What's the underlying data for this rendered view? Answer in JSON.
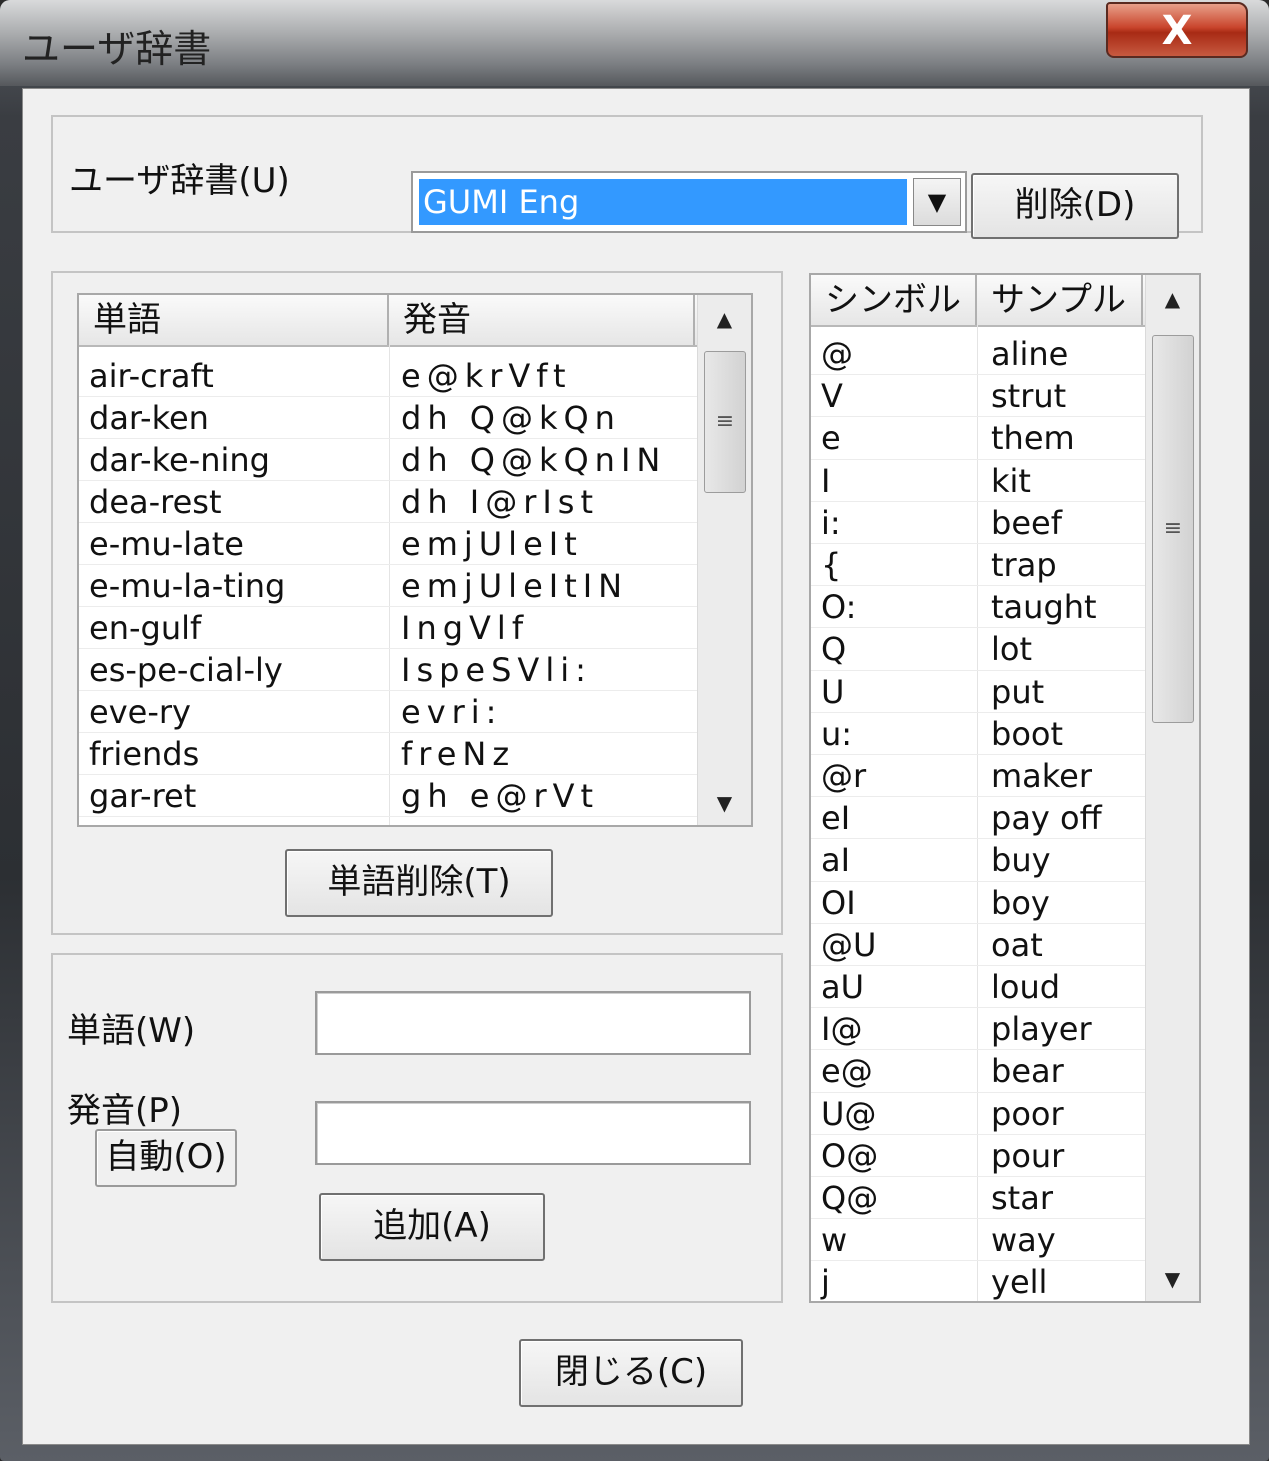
{
  "window": {
    "title": "ユーザ辞書",
    "close_glyph": "X"
  },
  "dictionary": {
    "label": "ユーザ辞書(U)",
    "selected": "GUMI Eng",
    "delete_label": "削除(D)"
  },
  "word_list": {
    "columns": [
      "単語",
      "発音"
    ],
    "rows": [
      {
        "word": "air-craft",
        "pron": "e@krVft"
      },
      {
        "word": "dar-ken",
        "pron": "dh Q@kQn"
      },
      {
        "word": "dar-ke-ning",
        "pron": "dh Q@kQnIN"
      },
      {
        "word": "dea-rest",
        "pron": "dh I@rIst"
      },
      {
        "word": "e-mu-late",
        "pron": "emjUleIt"
      },
      {
        "word": "e-mu-la-ting",
        "pron": "emjUleItIN"
      },
      {
        "word": "en-gulf",
        "pron": "IngVlf"
      },
      {
        "word": "es-pe-cial-ly",
        "pron": "IspeSVli:"
      },
      {
        "word": "eve-ry",
        "pron": "evri:"
      },
      {
        "word": "friends",
        "pron": "freNz"
      },
      {
        "word": "gar-ret",
        "pron": "gh e@rVt"
      }
    ],
    "delete_word_label": "単語削除(T)"
  },
  "entry": {
    "word_label": "単語(W)",
    "pron_label": "発音(P)",
    "auto_label": "自動(O)",
    "add_label": "追加(A)"
  },
  "symbols": {
    "columns": [
      "シンボル",
      "サンプル"
    ],
    "rows": [
      {
        "symbol": "@",
        "sample": "aline"
      },
      {
        "symbol": "V",
        "sample": "strut"
      },
      {
        "symbol": "e",
        "sample": "them"
      },
      {
        "symbol": "I",
        "sample": "kit"
      },
      {
        "symbol": "i:",
        "sample": "beef"
      },
      {
        "symbol": "{",
        "sample": "trap"
      },
      {
        "symbol": "O:",
        "sample": "taught"
      },
      {
        "symbol": "Q",
        "sample": "lot"
      },
      {
        "symbol": "U",
        "sample": "put"
      },
      {
        "symbol": "u:",
        "sample": "boot"
      },
      {
        "symbol": "@r",
        "sample": "maker"
      },
      {
        "symbol": "eI",
        "sample": "pay off"
      },
      {
        "symbol": "aI",
        "sample": "buy"
      },
      {
        "symbol": "OI",
        "sample": "boy"
      },
      {
        "symbol": "@U",
        "sample": "oat"
      },
      {
        "symbol": "aU",
        "sample": "loud"
      },
      {
        "symbol": "I@",
        "sample": "player"
      },
      {
        "symbol": "e@",
        "sample": "bear"
      },
      {
        "symbol": "U@",
        "sample": "poor"
      },
      {
        "symbol": "O@",
        "sample": "pour"
      },
      {
        "symbol": "Q@",
        "sample": "star"
      },
      {
        "symbol": "w",
        "sample": "way"
      },
      {
        "symbol": "j",
        "sample": "yell"
      }
    ]
  },
  "footer": {
    "close_label": "閉じる(C)"
  }
}
